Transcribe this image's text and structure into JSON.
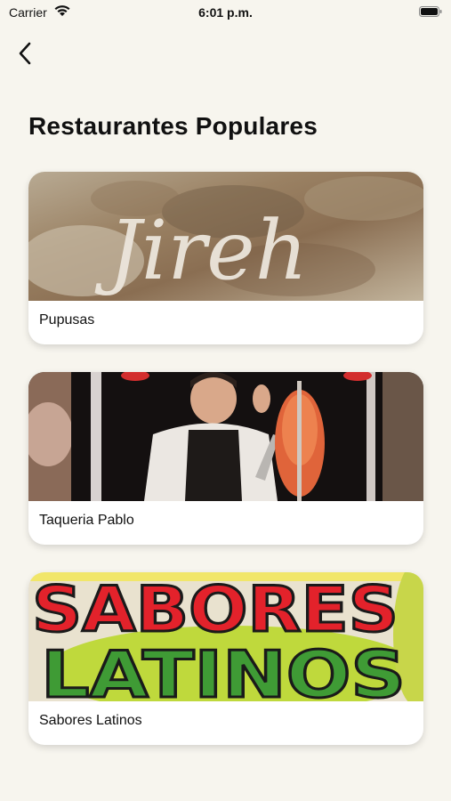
{
  "status_bar": {
    "carrier": "Carrier",
    "time": "6:01 p.m.",
    "wifi_icon": "wifi-icon",
    "battery_icon": "battery-icon"
  },
  "nav": {
    "back_icon": "chevron-left-icon"
  },
  "page": {
    "title": "Restaurantes Populares"
  },
  "restaurants": [
    {
      "name": "Pupusas",
      "image_text": "Jireh"
    },
    {
      "name": "Taqueria Pablo",
      "image_text": ""
    },
    {
      "name": "Sabores Latinos",
      "image_text": [
        "SABORES",
        "LATINOS"
      ]
    }
  ],
  "colors": {
    "background": "#f7f5ee",
    "card": "#ffffff",
    "sabores_red": "#e3222b",
    "latinos_green": "#3f9b35"
  }
}
